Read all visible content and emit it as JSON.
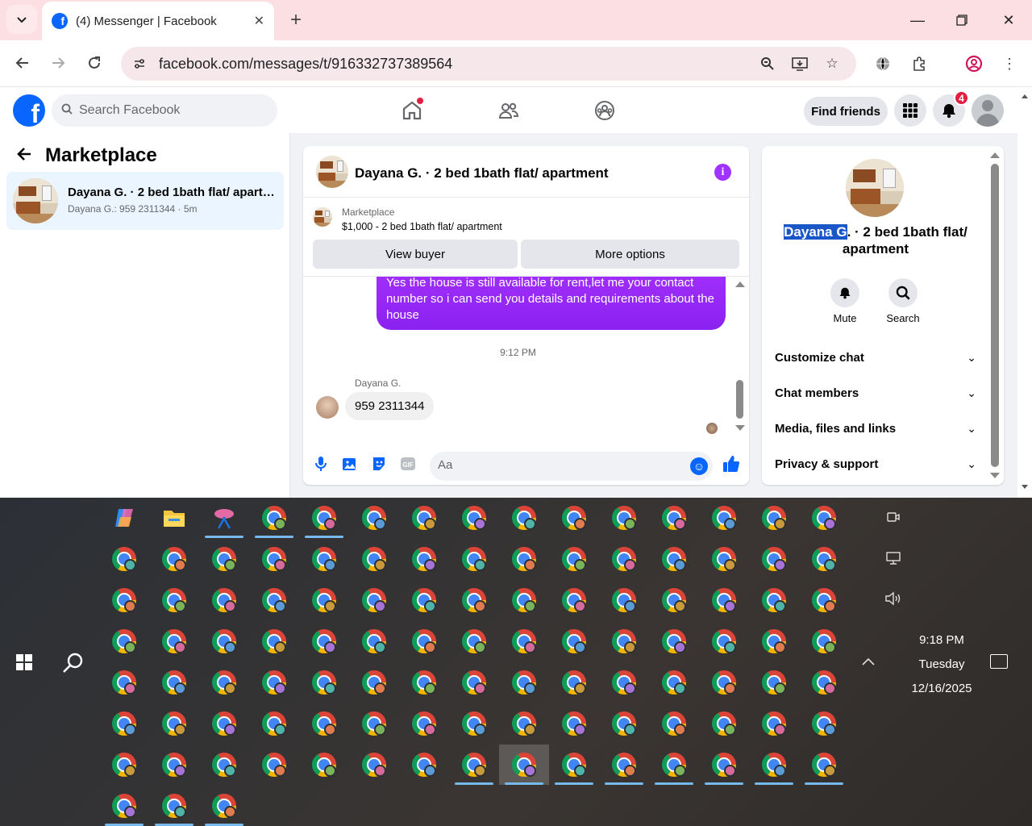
{
  "browser": {
    "tab_title": "(4) Messenger | Facebook",
    "url": "facebook.com/messages/t/916332737389564"
  },
  "fb": {
    "search_placeholder": "Search Facebook",
    "find_friends": "Find friends",
    "notification_count": "4"
  },
  "left": {
    "title": "Marketplace",
    "conversation": {
      "title": "Dayana G. · 2 bed 1bath flat/ apartment",
      "preview": "Dayana G.: 959 2311344 · 5m"
    }
  },
  "chat": {
    "header_name": "Dayana G. · 2 bed 1bath flat/ apartment",
    "marketplace_label": "Marketplace",
    "listing": "$1,000 - 2 bed 1bath flat/ apartment",
    "view_buyer": "View buyer",
    "more_options": "More options",
    "outgoing_message": "Yes the house is still available for rent,let me your contact number so i can send you details and requirements about the house",
    "timestamp": "9:12 PM",
    "sender_name": "Dayana G.",
    "incoming_message": "959 2311344",
    "composer_placeholder": "Aa"
  },
  "info": {
    "name_selected": "Dayana G",
    "name_rest": ". · 2 bed 1bath flat/ apartment",
    "mute": "Mute",
    "search": "Search",
    "sections": [
      "Customize chat",
      "Chat members",
      "Media, files and links",
      "Privacy & support"
    ]
  },
  "taskbar": {
    "time": "9:18 PM",
    "day": "Tuesday",
    "date": "12/16/2025"
  },
  "colors": {
    "fb_blue": "#0866ff",
    "messenger_purple": "#9f2dfb",
    "tab_strip": "#fbdfe2"
  }
}
